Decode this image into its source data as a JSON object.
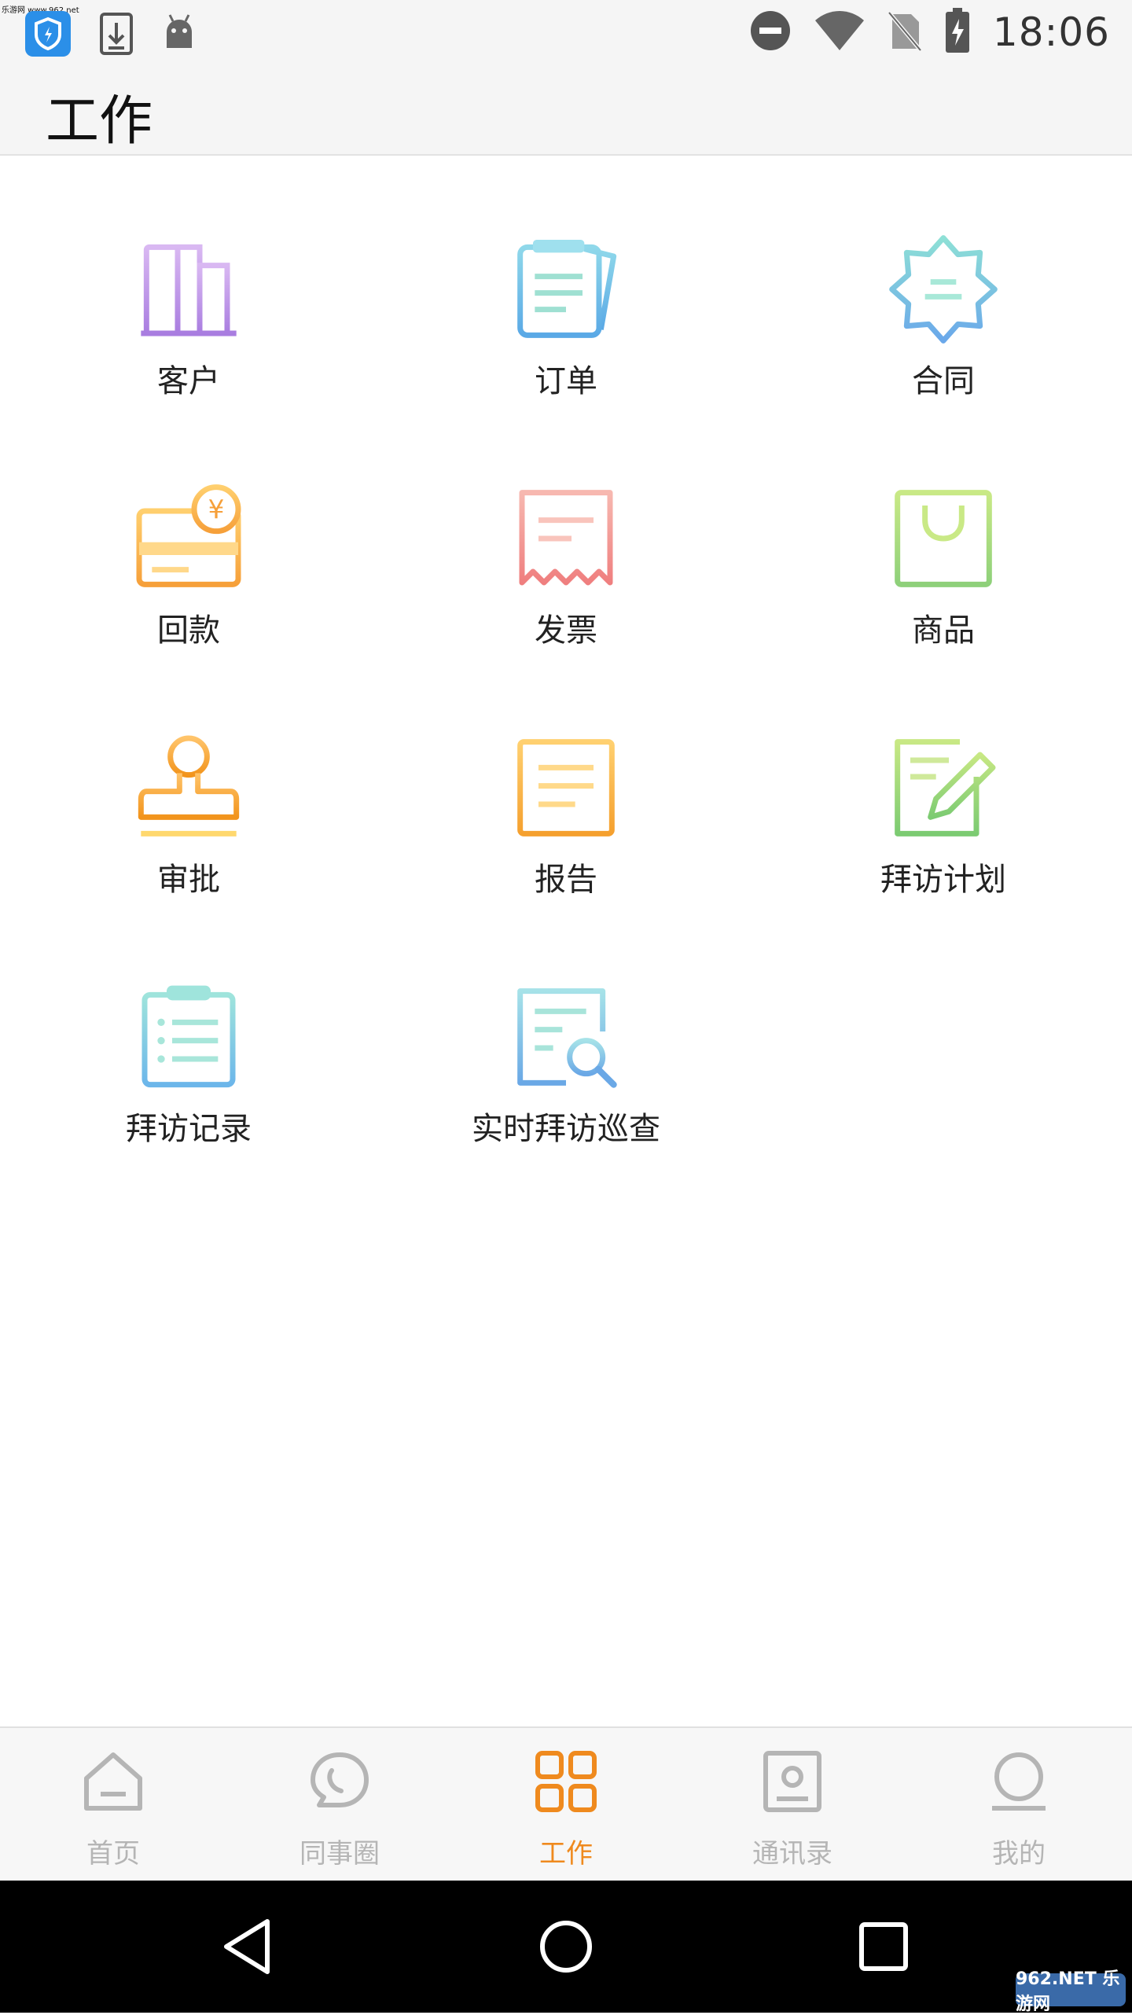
{
  "status_bar": {
    "watermark": "乐游网 www.962.net",
    "time": "18:06",
    "icons": [
      "shield-app-icon",
      "download-icon",
      "android-icon",
      "do-not-disturb-icon",
      "wifi-icon",
      "no-sim-icon",
      "battery-charging-icon"
    ]
  },
  "app_bar": {
    "title": "工作"
  },
  "grid": [
    {
      "label": "客户",
      "icon": "building-icon"
    },
    {
      "label": "订单",
      "icon": "order-doc-icon"
    },
    {
      "label": "合同",
      "icon": "contract-badge-icon"
    },
    {
      "label": "回款",
      "icon": "payment-card-icon"
    },
    {
      "label": "发票",
      "icon": "invoice-receipt-icon"
    },
    {
      "label": "商品",
      "icon": "shopping-bag-icon"
    },
    {
      "label": "审批",
      "icon": "stamp-icon"
    },
    {
      "label": "报告",
      "icon": "report-icon"
    },
    {
      "label": "拜访计划",
      "icon": "edit-plan-icon"
    },
    {
      "label": "拜访记录",
      "icon": "clipboard-list-icon"
    },
    {
      "label": "实时拜访巡查",
      "icon": "search-doc-icon"
    }
  ],
  "bottom_nav": [
    {
      "label": "首页",
      "icon": "home-icon",
      "active": false
    },
    {
      "label": "同事圈",
      "icon": "chat-icon",
      "active": false
    },
    {
      "label": "工作",
      "icon": "grid-icon",
      "active": true
    },
    {
      "label": "通讯录",
      "icon": "contacts-icon",
      "active": false
    },
    {
      "label": "我的",
      "icon": "profile-icon",
      "active": false
    }
  ],
  "colors": {
    "accent": "#ef8a1e",
    "inactive": "#b5b5b5"
  },
  "corner_badge": "962.NET 乐游网"
}
